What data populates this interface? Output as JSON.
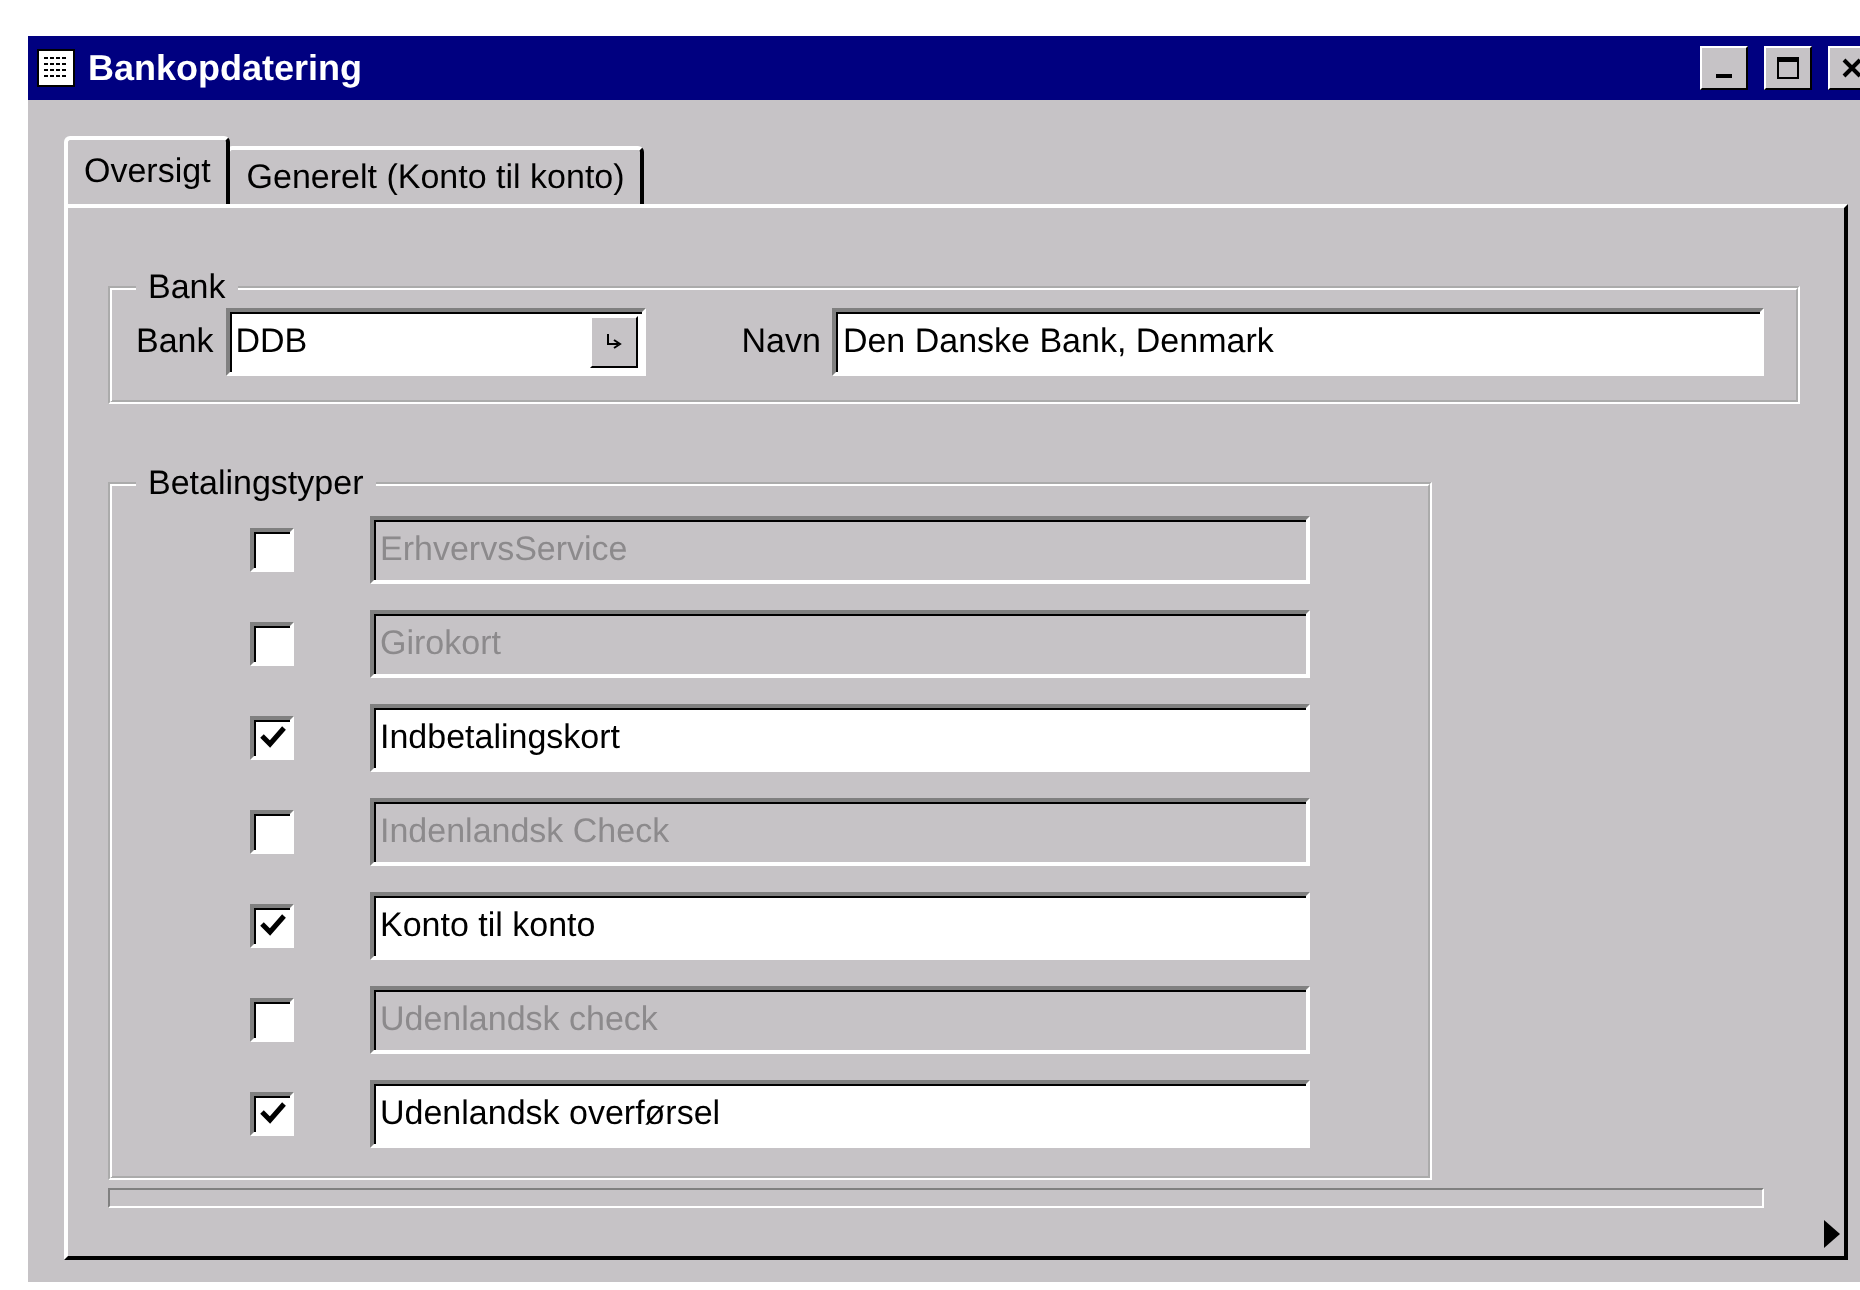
{
  "window": {
    "title": "Bankopdatering"
  },
  "tabs": [
    {
      "label": "Oversigt",
      "selected": true
    },
    {
      "label": "Generelt (Konto til konto)",
      "selected": false
    }
  ],
  "bank_group": {
    "title": "Bank",
    "bank_label": "Bank",
    "bank_value": "DDB",
    "name_label": "Navn",
    "name_value": "Den Danske Bank, Denmark"
  },
  "payment_group": {
    "title": "Betalingstyper",
    "rows": [
      {
        "label": "ErhvervsService",
        "checked": false,
        "disabled": true
      },
      {
        "label": "Girokort",
        "checked": false,
        "disabled": true
      },
      {
        "label": "Indbetalingskort",
        "checked": true,
        "disabled": false
      },
      {
        "label": "Indenlandsk Check",
        "checked": false,
        "disabled": true
      },
      {
        "label": "Konto til konto",
        "checked": true,
        "disabled": false
      },
      {
        "label": "Udenlandsk check",
        "checked": false,
        "disabled": true
      },
      {
        "label": "Udenlandsk overførsel",
        "checked": true,
        "disabled": false
      }
    ]
  }
}
